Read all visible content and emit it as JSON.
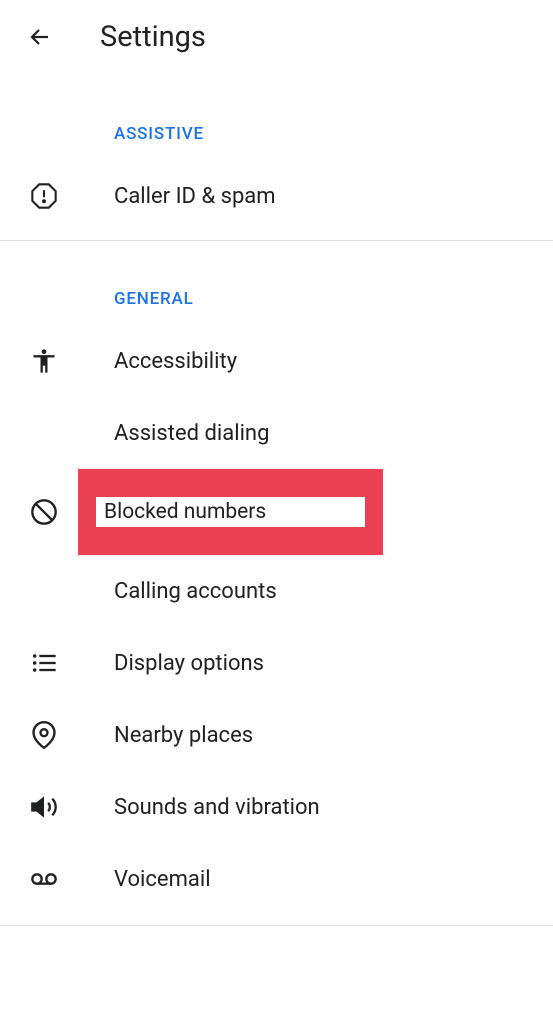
{
  "header": {
    "title": "Settings"
  },
  "sections": {
    "assistive": {
      "label": "ASSISTIVE",
      "items": {
        "caller_id": "Caller ID & spam"
      }
    },
    "general": {
      "label": "GENERAL",
      "items": {
        "accessibility": "Accessibility",
        "assisted_dialing": "Assisted dialing",
        "blocked_numbers": "Blocked numbers",
        "calling_accounts": "Calling accounts",
        "display_options": "Display options",
        "nearby_places": "Nearby places",
        "sounds_vibration": "Sounds and vibration",
        "voicemail": "Voicemail"
      }
    }
  }
}
